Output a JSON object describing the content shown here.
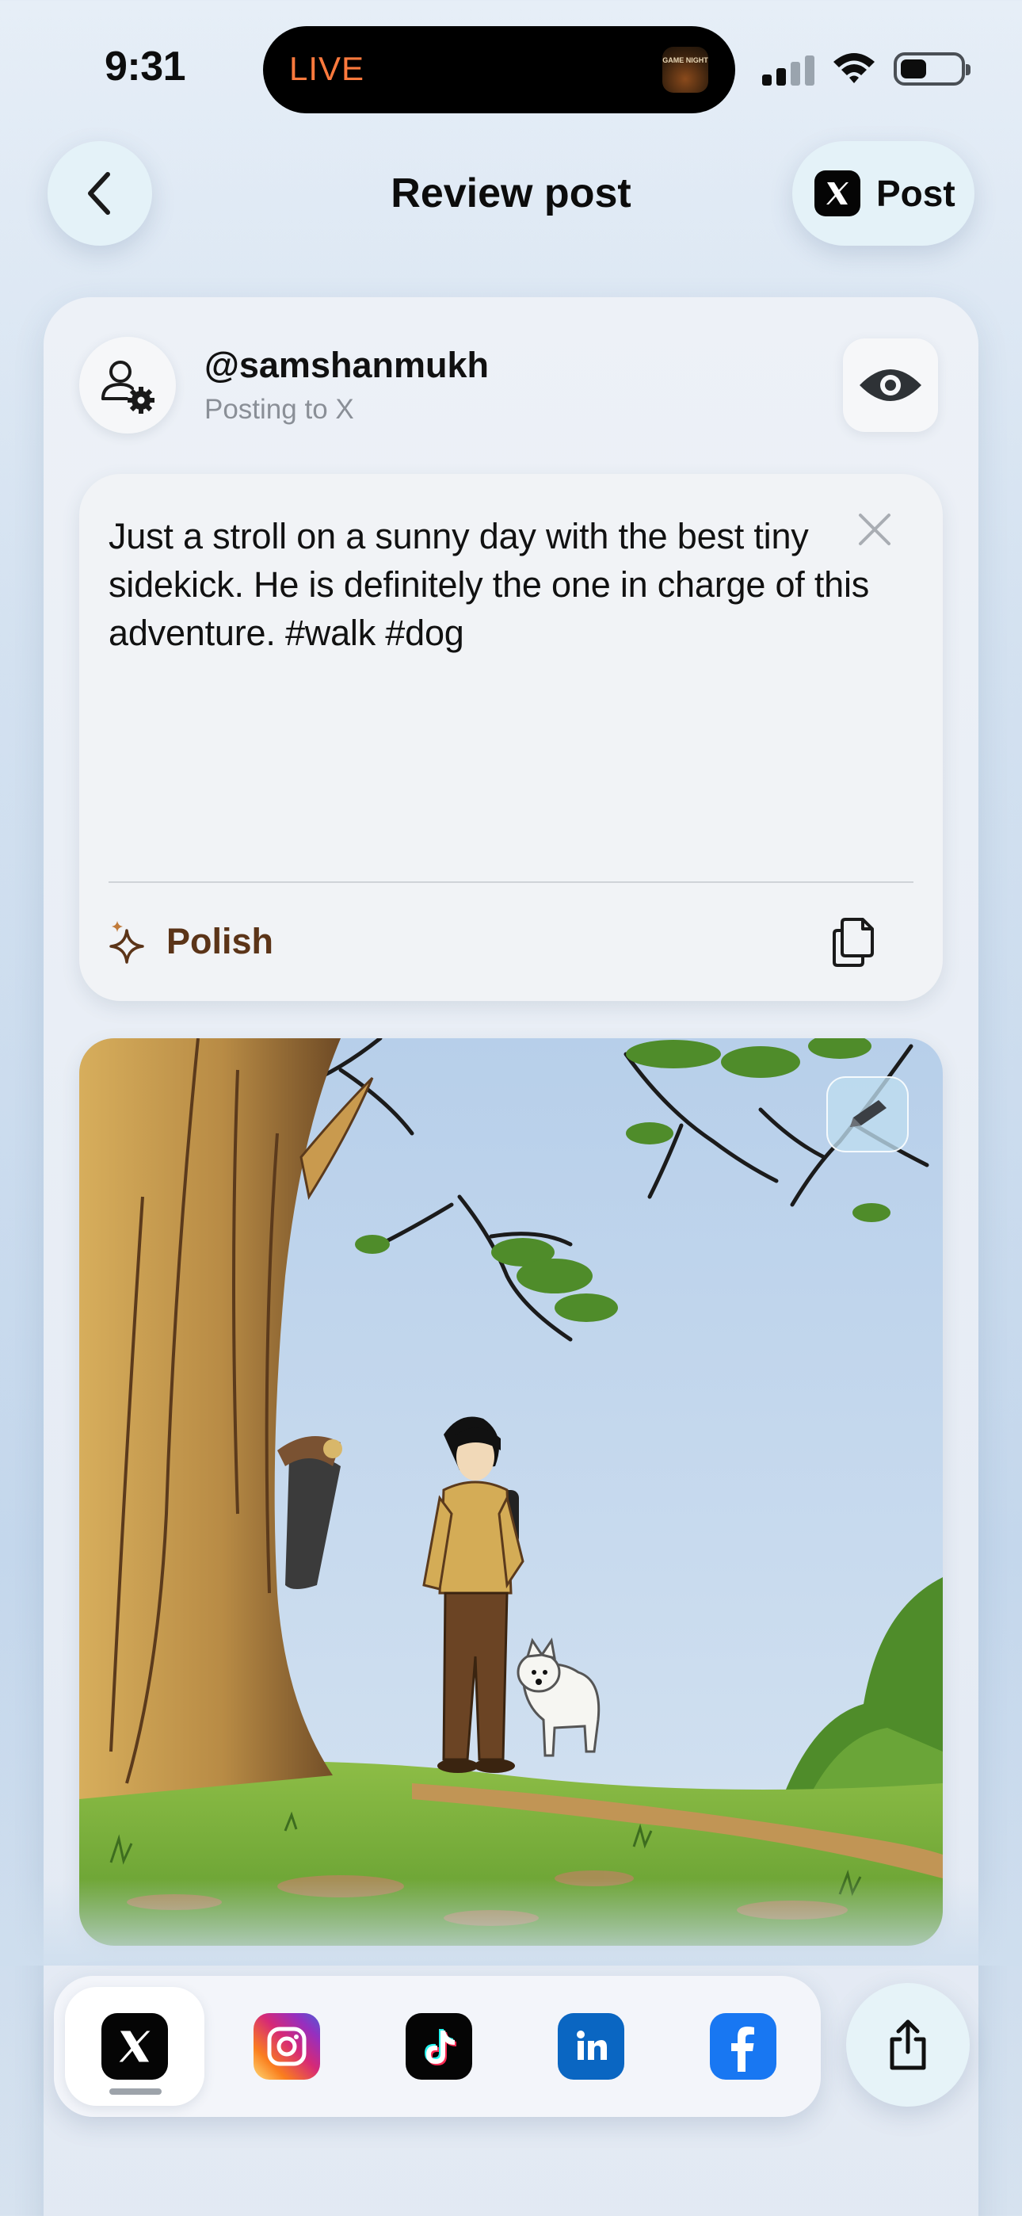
{
  "status_bar": {
    "time": "9:31",
    "live_activity_label": "LIVE",
    "live_activity_thumb_text": "GAME NIGHT",
    "signal_icon": "cellular-signal-icon",
    "wifi_icon": "wifi-icon",
    "battery_icon": "battery-icon",
    "battery_level": 0.45
  },
  "header": {
    "title": "Review post",
    "back_icon": "chevron-left-icon",
    "post_label": "Post",
    "post_icon": "x-logo-icon"
  },
  "account": {
    "handle": "@samshanmukh",
    "subtitle": "Posting to X",
    "avatar_icon": "user-settings-icon",
    "preview_icon": "eye-icon"
  },
  "composer": {
    "text": "Just a stroll on a sunny day with the best tiny sidekick. He is definitely the one in charge of this adventure. #walk #dog",
    "clear_icon": "close-icon",
    "polish_label": "Polish",
    "polish_icon": "sparkle-icon",
    "copy_icon": "copy-icon",
    "accent_color": "#5b3418"
  },
  "image": {
    "edit_icon": "pencil-icon"
  },
  "platforms": {
    "selected": "X",
    "items": [
      {
        "name": "X",
        "icon": "x-logo-icon",
        "color": "#000000"
      },
      {
        "name": "Instagram",
        "icon": "instagram-icon",
        "color": "#d62976"
      },
      {
        "name": "TikTok",
        "icon": "tiktok-icon",
        "color": "#000000"
      },
      {
        "name": "LinkedIn",
        "icon": "linkedin-icon",
        "color": "#0a66c2"
      },
      {
        "name": "Facebook",
        "icon": "facebook-icon",
        "color": "#1877f2"
      }
    ],
    "share_icon": "share-icon"
  }
}
